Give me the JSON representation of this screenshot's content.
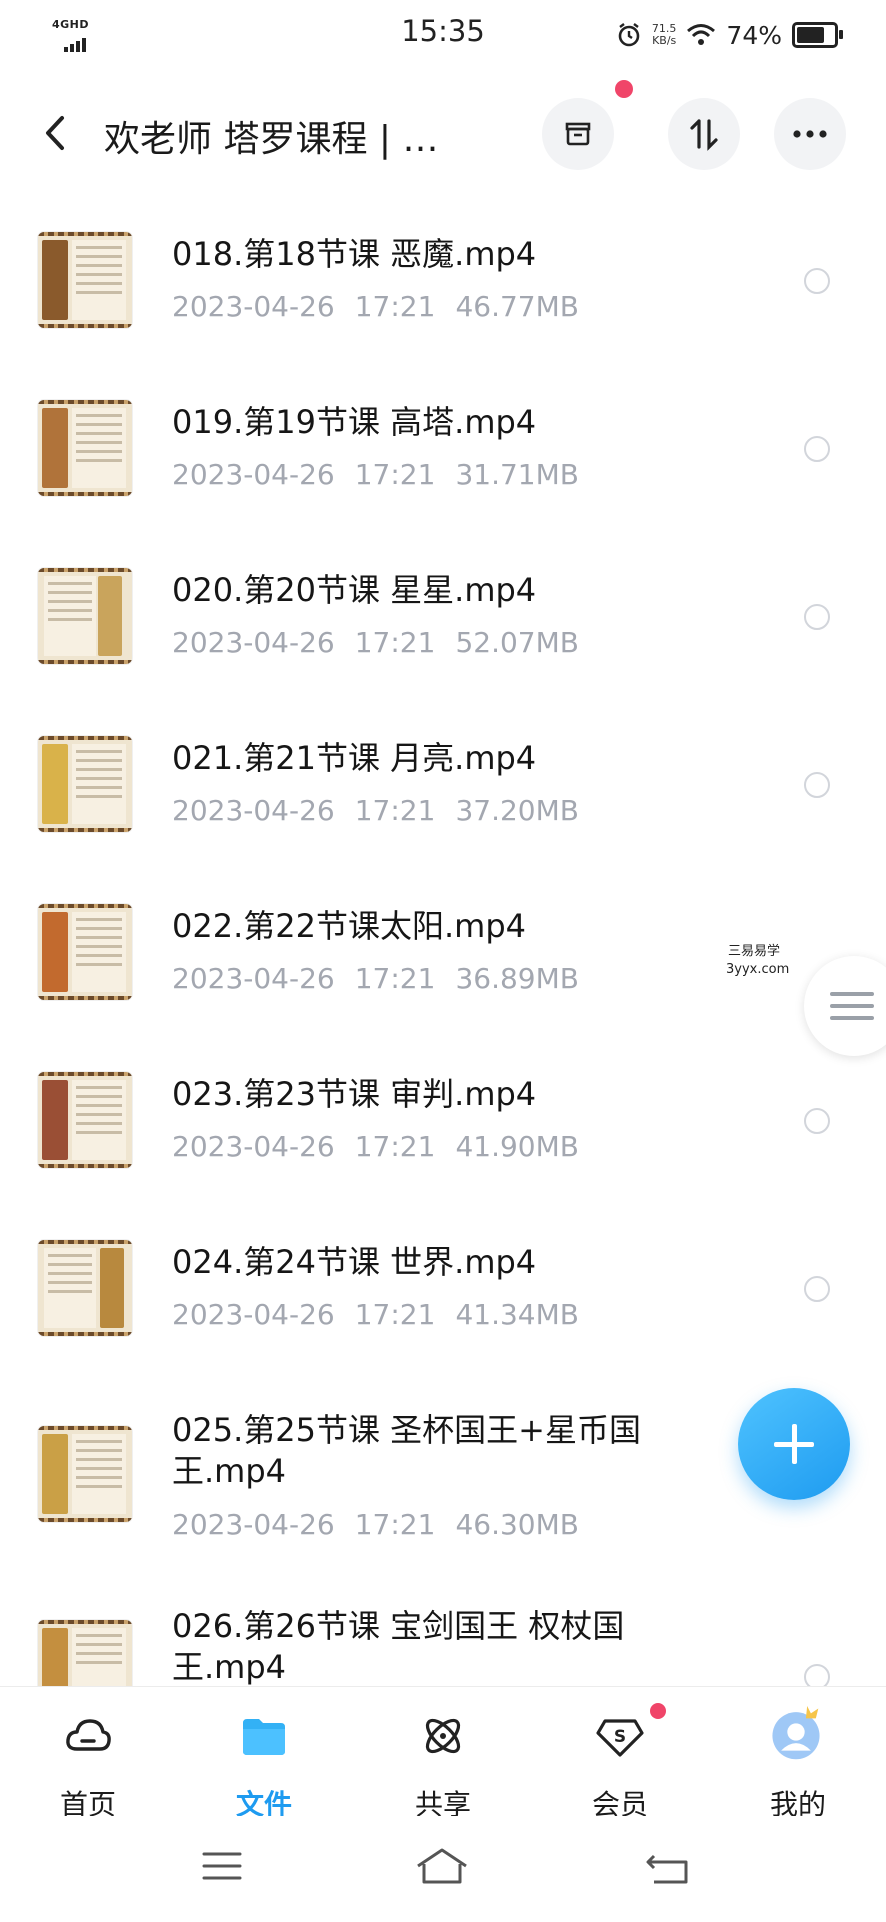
{
  "status_bar": {
    "network": "4GHD",
    "time": "15:35",
    "speed_value": "71.5",
    "speed_unit": "KB/s",
    "battery": "74%",
    "battery_level": 0.74
  },
  "header": {
    "title": "欢老师 塔罗课程 | …",
    "icons": [
      "back-icon",
      "archive-icon",
      "sort-icon",
      "more-icon"
    ]
  },
  "files": [
    {
      "name": "018.第18节课 恶魔.mp4",
      "date": "2023-04-26",
      "time": "17:21",
      "size": "46.77MB"
    },
    {
      "name": "019.第19节课 高塔.mp4",
      "date": "2023-04-26",
      "time": "17:21",
      "size": "31.71MB"
    },
    {
      "name": "020.第20节课 星星.mp4",
      "date": "2023-04-26",
      "time": "17:21",
      "size": "52.07MB"
    },
    {
      "name": "021.第21节课 月亮.mp4",
      "date": "2023-04-26",
      "time": "17:21",
      "size": "37.20MB"
    },
    {
      "name": "022.第22节课太阳.mp4",
      "date": "2023-04-26",
      "time": "17:21",
      "size": "36.89MB"
    },
    {
      "name": "023.第23节课 审判.mp4",
      "date": "2023-04-26",
      "time": "17:21",
      "size": "41.90MB"
    },
    {
      "name": "024.第24节课 世界.mp4",
      "date": "2023-04-26",
      "time": "17:21",
      "size": "41.34MB"
    },
    {
      "name": "025.第25节课 圣杯国王+星币国王.mp4",
      "date": "2023-04-26",
      "time": "17:21",
      "size": "46.30MB"
    },
    {
      "name": "026.第26节课 宝剑国王 权杖国王.mp4",
      "date": "",
      "time": "",
      "size": ""
    }
  ],
  "watermark": {
    "name": "三易易学",
    "url": "3yyx.com"
  },
  "bottom_nav": [
    {
      "label": "首页",
      "icon": "cloud-home-icon",
      "active": false
    },
    {
      "label": "文件",
      "icon": "folder-icon",
      "active": true
    },
    {
      "label": "共享",
      "icon": "share-atom-icon",
      "active": false
    },
    {
      "label": "会员",
      "icon": "vip-diamond-icon",
      "active": false
    },
    {
      "label": "我的",
      "icon": "avatar-icon",
      "active": false
    }
  ],
  "colors": {
    "accent": "#1e9bf0",
    "notification": "#f04569",
    "meta_text": "#a3a7b0"
  }
}
